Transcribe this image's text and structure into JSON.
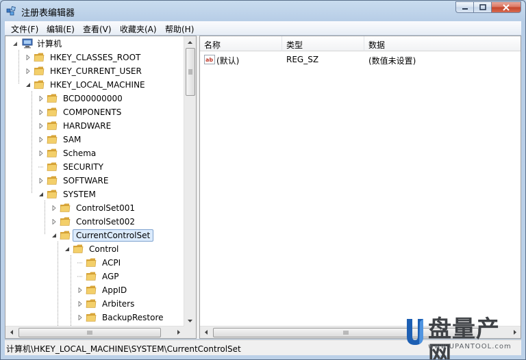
{
  "window": {
    "title": "注册表编辑器"
  },
  "title_controls": {
    "minimize_icon": "minimize-icon",
    "maximize_icon": "maximize-icon",
    "close_icon": "close-icon"
  },
  "menu": [
    "文件(F)",
    "编辑(E)",
    "查看(V)",
    "收藏夹(A)",
    "帮助(H)"
  ],
  "tree": {
    "root": "计算机",
    "nodes": [
      {
        "label": "HKEY_CLASSES_ROOT",
        "level": 1,
        "expander": "collapsed"
      },
      {
        "label": "HKEY_CURRENT_USER",
        "level": 1,
        "expander": "collapsed"
      },
      {
        "label": "HKEY_LOCAL_MACHINE",
        "level": 1,
        "expander": "expanded"
      },
      {
        "label": "BCD00000000",
        "level": 2,
        "expander": "collapsed"
      },
      {
        "label": "COMPONENTS",
        "level": 2,
        "expander": "collapsed"
      },
      {
        "label": "HARDWARE",
        "level": 2,
        "expander": "collapsed"
      },
      {
        "label": "SAM",
        "level": 2,
        "expander": "collapsed"
      },
      {
        "label": "Schema",
        "level": 2,
        "expander": "collapsed"
      },
      {
        "label": "SECURITY",
        "level": 2,
        "expander": "none"
      },
      {
        "label": "SOFTWARE",
        "level": 2,
        "expander": "collapsed"
      },
      {
        "label": "SYSTEM",
        "level": 2,
        "expander": "expanded"
      },
      {
        "label": "ControlSet001",
        "level": 3,
        "expander": "collapsed"
      },
      {
        "label": "ControlSet002",
        "level": 3,
        "expander": "collapsed"
      },
      {
        "label": "CurrentControlSet",
        "level": 3,
        "expander": "expanded",
        "selected": true
      },
      {
        "label": "Control",
        "level": 4,
        "expander": "expanded"
      },
      {
        "label": "ACPI",
        "level": 5,
        "expander": "none"
      },
      {
        "label": "AGP",
        "level": 5,
        "expander": "none"
      },
      {
        "label": "AppID",
        "level": 5,
        "expander": "collapsed"
      },
      {
        "label": "Arbiters",
        "level": 5,
        "expander": "collapsed"
      },
      {
        "label": "BackupRestore",
        "level": 5,
        "expander": "collapsed"
      }
    ]
  },
  "list": {
    "columns": [
      "名称",
      "类型",
      "数据"
    ],
    "rows": [
      {
        "name": "(默认)",
        "type": "REG_SZ",
        "data": "(数值未设置)",
        "icon": "string-value-icon"
      }
    ]
  },
  "status": {
    "path": "计算机\\HKEY_LOCAL_MACHINE\\SYSTEM\\CurrentControlSet"
  },
  "watermark": {
    "brand": "盘量产网",
    "url": "www.UPANTOOL.com"
  },
  "colors": {
    "selection_bg": "#dcebfc",
    "selection_border": "#7da2ce",
    "folder": "#e8b84a",
    "close_button": "#c5442a"
  }
}
